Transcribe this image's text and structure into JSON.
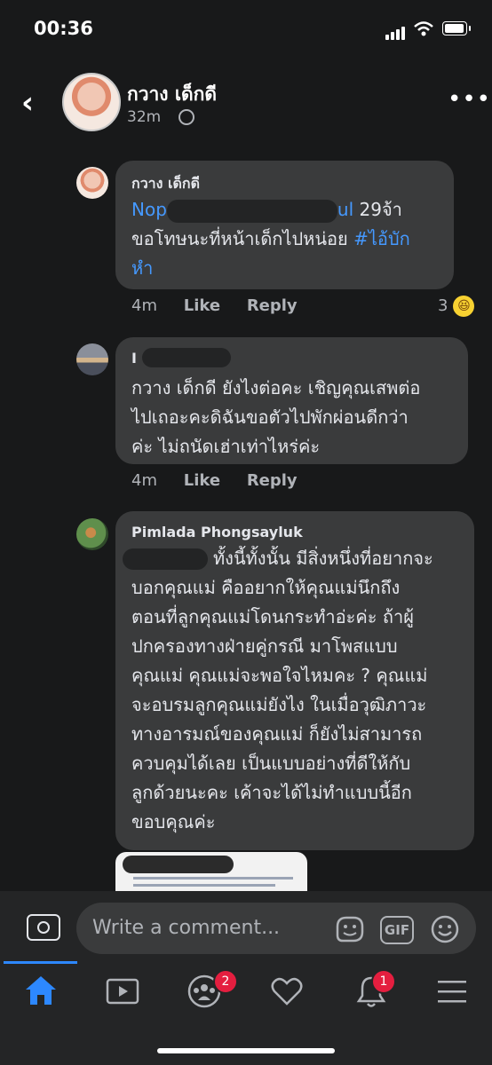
{
  "status_bar": {
    "time": "00:36"
  },
  "header": {
    "name": "กวาง เด็กดี",
    "time": "32m"
  },
  "comments": [
    {
      "name": "กวาง เด็กดี",
      "text_prefix": "Nop",
      "text_suffix": "ul",
      "text_after": " 29จ้า",
      "line2": "ขอโทษนะที่หน้าเด็กไปหน่อย",
      "hashtag": "#ไอ้บัก",
      "line3": "หำ",
      "time": "4m",
      "like": "Like",
      "reply": "Reply",
      "reaction_count": "3"
    },
    {
      "name": "I",
      "text_line1": "กวาง เด็กดี ยังไงต่อคะ เชิญคุณเสพต่อ",
      "text_line2": "ไปเถอะคะดิฉันขอตัวไปพักผ่อนดีกว่า",
      "text_line3": "ค่ะ ไม่ถนัดเฮ่าเท่าไหร่ค่ะ",
      "time": "4m",
      "like": "Like",
      "reply": "Reply"
    },
    {
      "name": "Pimlada Phongsayluk",
      "lines": [
        "ทั้งนี้ทั้งนั้น มีสิ่งหนึ่งที่อยากจะ",
        "บอกคุณแม่ คืออยากให้คุณแม่นึกถึง",
        "ตอนที่ลูกคุณแม่โดนกระทำอ่ะค่ะ ถ้าผู้",
        "ปกครองทางฝ่ายคู่กรณี มาโพสแบบ",
        "คุณแม่ คุณแม่จะพอใจไหมคะ ? คุณแม่",
        "จะอบรมลูกคุณแม่ยังไง ในเมื่อวุฒิภาวะ",
        "ทางอารมณ์ของคุณแม่ ก็ยังไม่สามารถ",
        "ควบคุมได้เลย เป็นแบบอย่างที่ดีให้กับ",
        "ลูกด้วยนะคะ เค้าจะได้ไม่ทำแบบนี้อีก",
        "ขอบคุณค่ะ"
      ]
    }
  ],
  "composer": {
    "placeholder": "Write a comment...",
    "gif": "GIF"
  },
  "nav": {
    "groups_badge": "2",
    "notifications_badge": "1"
  },
  "icons": [
    "back-icon",
    "globe-icon",
    "more-icon",
    "camera-icon",
    "sticker-icon",
    "gif-icon",
    "emoji-icon",
    "home-icon",
    "watch-icon",
    "groups-icon",
    "dating-icon",
    "bell-icon",
    "menu-icon"
  ],
  "colors": {
    "background": "#18191a",
    "bubble": "#3a3b3c",
    "link": "#4599ff",
    "accent": "#2d88ff",
    "badge": "#e41e3f"
  }
}
